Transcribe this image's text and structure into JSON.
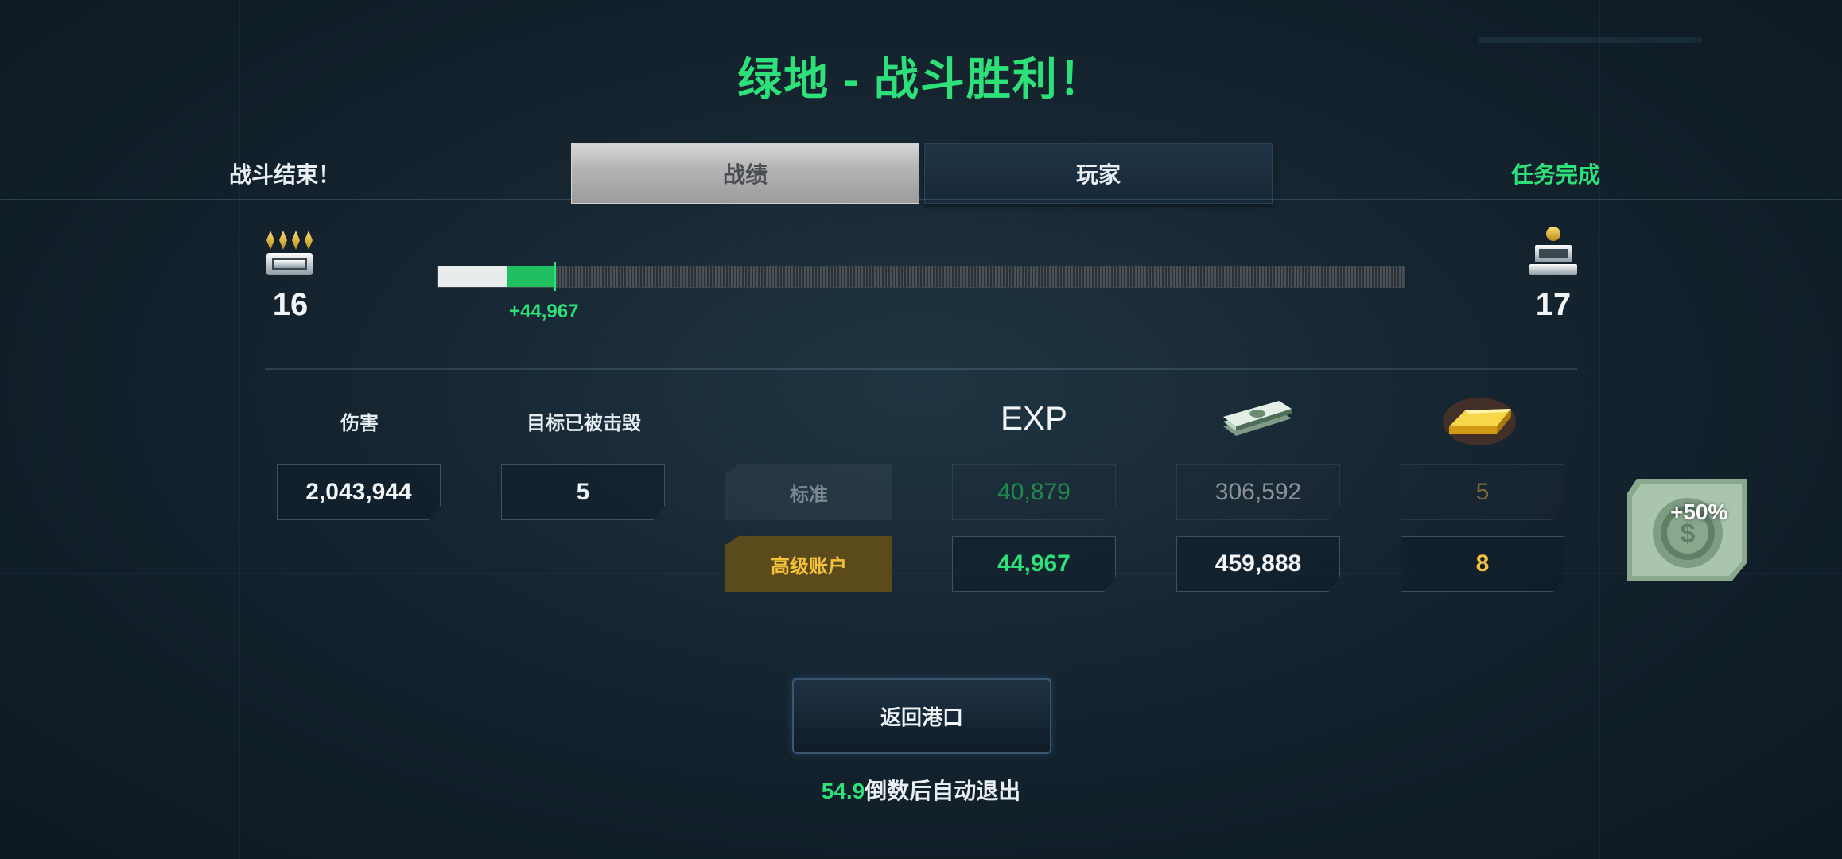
{
  "header": {
    "title": "绿地 - 战斗胜利！"
  },
  "status": {
    "battle_over": "战斗结束！",
    "mission": "任务完成"
  },
  "tabs": [
    {
      "label": "战绩",
      "active": true
    },
    {
      "label": "玩家",
      "active": false
    }
  ],
  "rank": {
    "current": {
      "level": "16",
      "icon": "rank-insignia-icon"
    },
    "next": {
      "level": "17",
      "icon": "rank-insignia-icon"
    },
    "progress_start_fraction": 0.072,
    "progress_fraction": 0.12,
    "gain_label": "+44,967"
  },
  "stats": {
    "damage_label": "伤害",
    "damage_value": "2,043,944",
    "destroyed_label": "目标已被击毁",
    "destroyed_value": "5"
  },
  "rewards": {
    "exp_header": "EXP",
    "cash_icon": "cash-stack-icon",
    "gold_icon": "gold-bar-icon",
    "standard": {
      "label": "标准",
      "exp": "40,879",
      "cash": "306,592",
      "gold": "5"
    },
    "premium": {
      "label": "高级账户",
      "exp": "44,967",
      "cash": "459,888",
      "gold": "8"
    },
    "bonus": {
      "label": "+50%",
      "icon": "dollar-bonus-icon"
    }
  },
  "actions": {
    "return_label": "返回港口"
  },
  "countdown": {
    "seconds": "54.9",
    "text": "倒数后自动退出"
  },
  "colors": {
    "accent_green": "#2ee07a",
    "gold": "#e8b328",
    "premium_bg": "#5a4a1c"
  }
}
